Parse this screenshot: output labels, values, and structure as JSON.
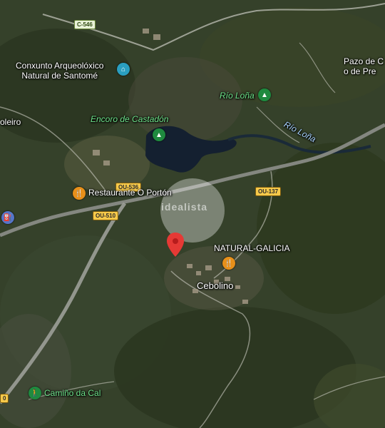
{
  "map": {
    "type": "satellite",
    "roads": {
      "c546": "C-546",
      "ou536": "OU-536",
      "ou510": "OU-510",
      "ou137": "OU-137",
      "edge_partial": "0"
    },
    "places": {
      "arqueo": "Conxunto Arqueolóxico\nNatural de Santomé",
      "pazo": "Pazo de C\no de Pre",
      "cebolino": "Cebolino",
      "leiro": "oleiro"
    },
    "parks": {
      "rio_lona_park": "Río Loña",
      "encoro": "Encoro de Castadón",
      "camino": "Camiño da Cal"
    },
    "water": {
      "rio_lona_river": "Río Loña"
    },
    "food": {
      "porton": "Restaurante O Portón",
      "natural_galicia": "NATURAL-GALICIA"
    },
    "watermark": "idealista"
  }
}
